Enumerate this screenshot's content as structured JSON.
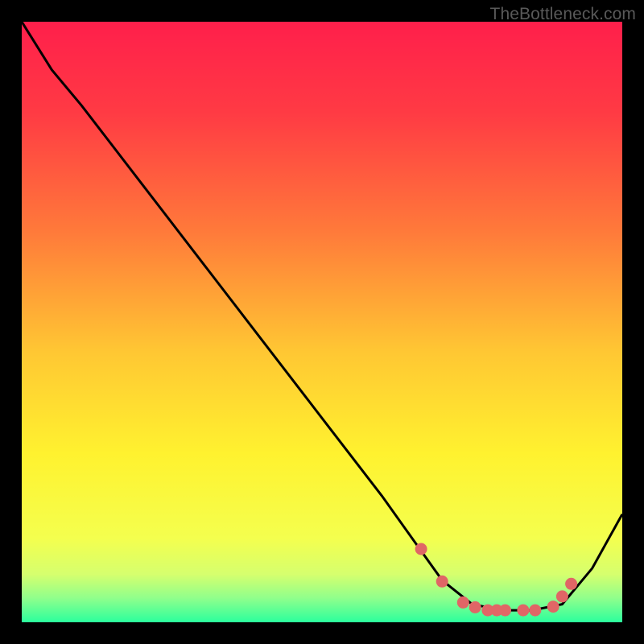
{
  "watermark": "TheBottleneck.com",
  "chart_data": {
    "type": "line",
    "title": "",
    "xlabel": "",
    "ylabel": "",
    "xlim": [
      0,
      100
    ],
    "ylim": [
      0,
      100
    ],
    "grid": false,
    "legend": false,
    "curve": {
      "x": [
        0,
        5,
        10,
        20,
        30,
        40,
        50,
        60,
        65,
        70,
        75,
        80,
        85,
        90,
        95,
        100
      ],
      "y": [
        100,
        92,
        86,
        73,
        60,
        47,
        34,
        21,
        14,
        7,
        3,
        2,
        2,
        3,
        9,
        18
      ]
    },
    "markers": {
      "x": [
        66.5,
        70.0,
        73.5,
        75.5,
        77.6,
        79.1,
        80.5,
        83.5,
        85.5,
        88.5,
        90.0,
        91.5
      ],
      "y": [
        12.2,
        6.8,
        3.3,
        2.5,
        2.0,
        2.0,
        2.0,
        2.0,
        2.0,
        2.6,
        4.3,
        6.4
      ]
    },
    "gradient_stops": [
      {
        "pos": 0.0,
        "color": "#ff1f4b"
      },
      {
        "pos": 0.15,
        "color": "#ff3a44"
      },
      {
        "pos": 0.35,
        "color": "#ff7a3a"
      },
      {
        "pos": 0.55,
        "color": "#ffc733"
      },
      {
        "pos": 0.72,
        "color": "#fff22f"
      },
      {
        "pos": 0.86,
        "color": "#f4ff4e"
      },
      {
        "pos": 0.92,
        "color": "#d6ff6e"
      },
      {
        "pos": 0.96,
        "color": "#8fff8c"
      },
      {
        "pos": 1.0,
        "color": "#2bff9d"
      }
    ],
    "line_color": "#000000",
    "marker_color": "#e06666"
  }
}
